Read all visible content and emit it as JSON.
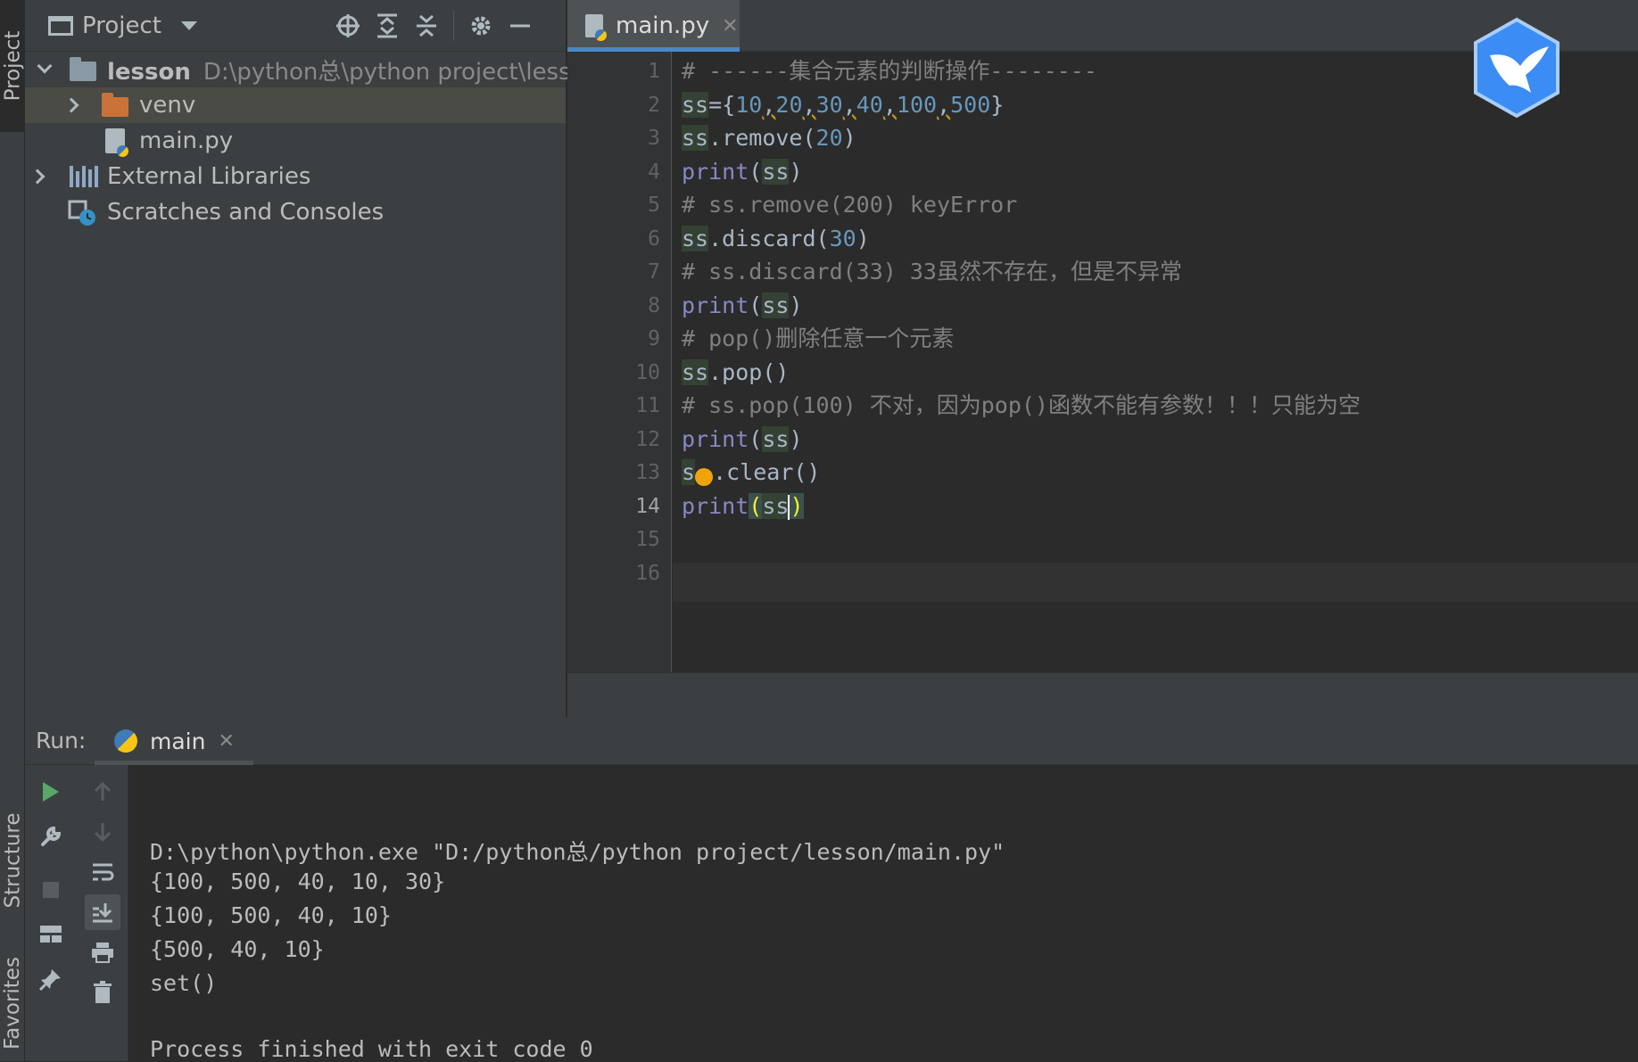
{
  "tool_strip": {
    "project": "Project",
    "structure": "Structure",
    "favorites": "Favorites"
  },
  "project_panel": {
    "title": "Project",
    "tree": {
      "root_name": "lesson",
      "root_path": "D:\\python总\\python project\\lesson",
      "venv": "venv",
      "main_file": "main.py",
      "external_libs": "External Libraries",
      "scratches": "Scratches and Consoles"
    }
  },
  "editor": {
    "tab_label": "main.py",
    "line_numbers": [
      "1",
      "2",
      "3",
      "4",
      "5",
      "6",
      "7",
      "8",
      "9",
      "10",
      "11",
      "12",
      "13",
      "14",
      "15",
      "16"
    ],
    "current_line": "14",
    "lines": {
      "l1": "# ------集合元素的判断操作--------",
      "l2": {
        "a": "ss",
        "b": "={",
        "n1": "10",
        "n2": "20",
        "n3": "30",
        "n4": "40",
        "n5": "100",
        "n6": "500",
        "c": ",",
        "end": "}"
      },
      "l3": {
        "a": "ss",
        "b": ".remove(",
        "n": "20",
        "end": ")"
      },
      "l4": {
        "kw": "print",
        "p1": "(",
        "a": "ss",
        "p2": ")"
      },
      "l5": "# ss.remove(200) keyError",
      "l6": {
        "a": "ss",
        "b": ".discard(",
        "n": "30",
        "end": ")"
      },
      "l7": "# ss.discard(33) 33虽然不存在，但是不异常",
      "l8": {
        "kw": "print",
        "p1": "(",
        "a": "ss",
        "p2": ")"
      },
      "l9": "# pop()删除任意一个元素",
      "l10": {
        "a": "ss",
        "b": ".pop()"
      },
      "l11": "# ss.pop(100) 不对，因为pop()函数不能有参数！！！只能为空",
      "l12": {
        "kw": "print",
        "p1": "(",
        "a": "ss",
        "p2": ")"
      },
      "l13": {
        "a": "s",
        "b": ".clear()"
      },
      "l14": {
        "kw": "print",
        "p1": "(",
        "a": "ss",
        "p2": ")"
      }
    }
  },
  "run_panel": {
    "label": "Run:",
    "tab_label": "main",
    "output": [
      "D:\\python\\python.exe \"D:/python总/python project/lesson/main.py\"",
      "{100, 500, 40, 10, 30}",
      "{100, 500, 40, 10}",
      "{500, 40, 10}",
      "set()",
      "",
      "Process finished with exit code 0"
    ]
  },
  "colors": {
    "background": "#2b2b2b",
    "panel": "#3c3f41",
    "keyword": "#8888c6",
    "number": "#6897bb",
    "comment": "#808080",
    "accent": "#4a88c7"
  },
  "icons": {
    "locate": "crosshair-icon",
    "expand_all": "expand-all-icon",
    "collapse_all": "collapse-all-icon",
    "settings": "gear-icon",
    "hide": "minimize-icon",
    "rerun": "play-icon",
    "settings_run": "wrench-icon",
    "stop": "stop-icon",
    "layout": "layout-icon",
    "pin": "pin-icon",
    "up": "arrow-up-icon",
    "down": "arrow-down-icon",
    "soft_wrap": "soft-wrap-icon",
    "scroll_end": "scroll-to-end-icon",
    "print": "print-icon",
    "trash": "trash-icon"
  }
}
